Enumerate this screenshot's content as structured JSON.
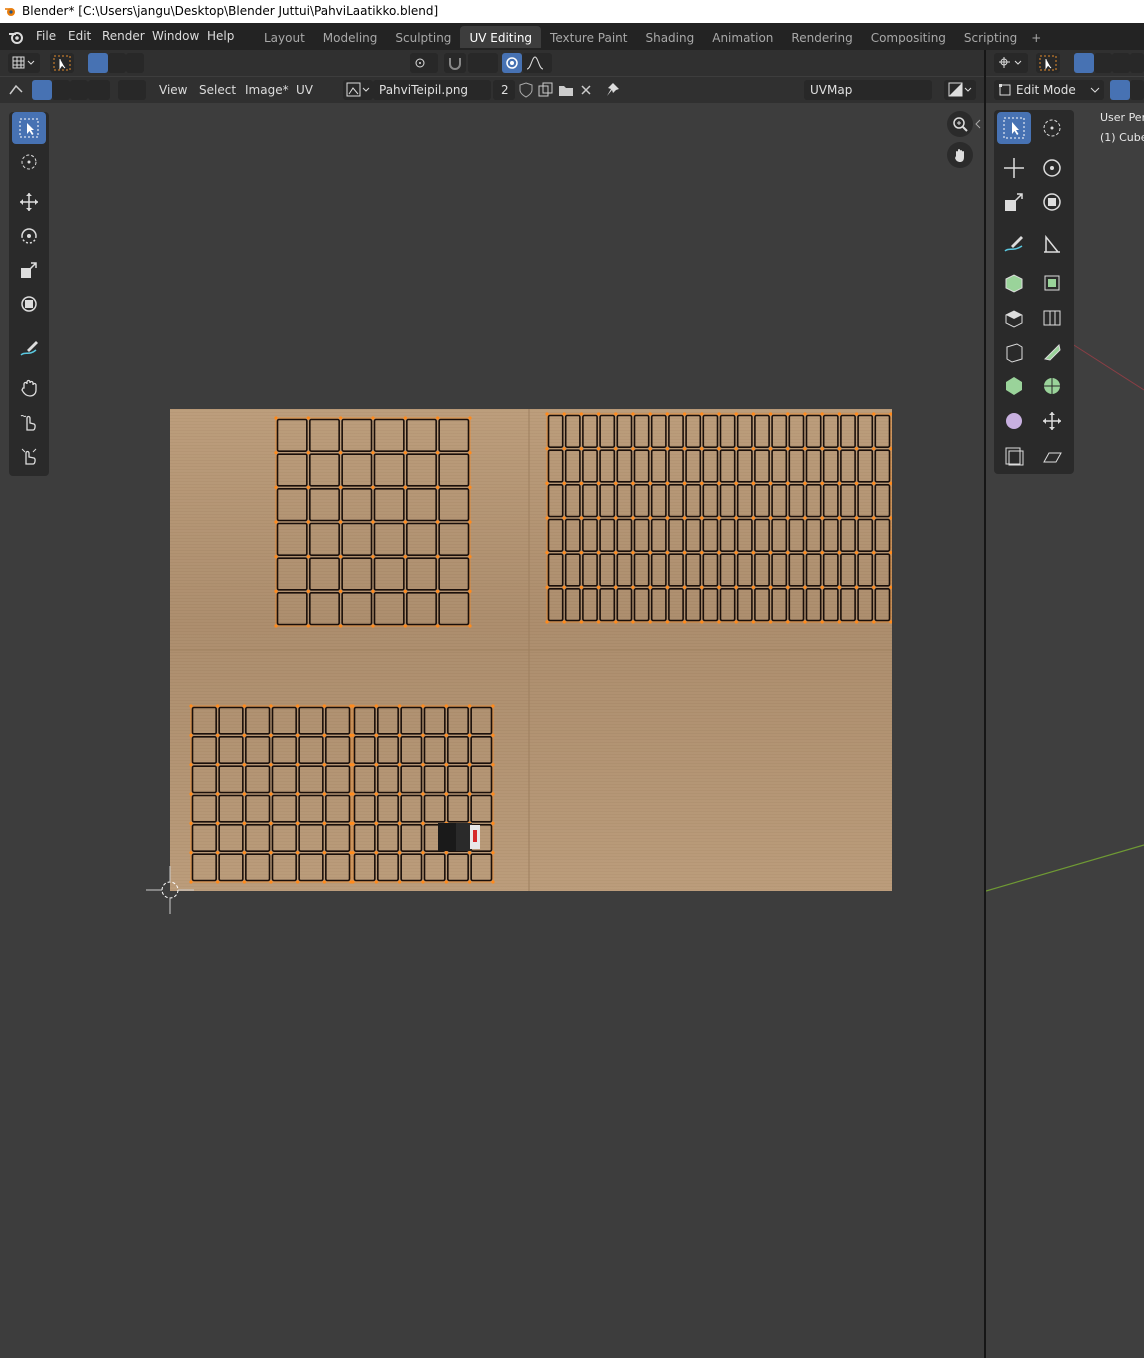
{
  "window": {
    "title": "Blender* [C:\\Users\\jangu\\Desktop\\Blender Juttui\\PahviLaatikko.blend]"
  },
  "menu": [
    "File",
    "Edit",
    "Render",
    "Window",
    "Help"
  ],
  "workspace_tabs": [
    {
      "label": "Layout",
      "active": false
    },
    {
      "label": "Modeling",
      "active": false
    },
    {
      "label": "Sculpting",
      "active": false
    },
    {
      "label": "UV Editing",
      "active": true
    },
    {
      "label": "Texture Paint",
      "active": false
    },
    {
      "label": "Shading",
      "active": false
    },
    {
      "label": "Animation",
      "active": false
    },
    {
      "label": "Rendering",
      "active": false
    },
    {
      "label": "Compositing",
      "active": false
    },
    {
      "label": "Scripting",
      "active": false
    }
  ],
  "workspace_add": "+",
  "uv_editor": {
    "header_menus": [
      "View",
      "Select",
      "Image*",
      "UV"
    ],
    "image_name": "PahviTeipil.png",
    "users_count": "2",
    "uv_map": "UVMap",
    "texture_colors": {
      "base": "#b79877",
      "light": "#c4a684",
      "dark": "#8e7154",
      "uv_edge": "#1a0f0a",
      "uv_vertex": "#ff8a1c"
    }
  },
  "viewport": {
    "mode": "Edit Mode",
    "overlay_line1": "User Pers",
    "overlay_line2": "(1) Cube"
  },
  "tools_left": [
    "select-box-icon",
    "cursor-icon",
    "move-icon",
    "rotate-icon",
    "scale-icon",
    "transform-icon",
    "annotate-icon",
    "grab-icon",
    "relax-icon",
    "pinch-icon"
  ],
  "tools_right": [
    "select-box-icon",
    "cursor-icon",
    "move-icon",
    "rotate-icon",
    "scale-icon",
    "transform-icon",
    "annotate-icon",
    "measure-icon",
    "add-cube-icon",
    "extrude-icon",
    "inset-icon",
    "bevel-icon",
    "loop-cut-icon",
    "knife-icon",
    "poly-build-icon",
    "spin-icon",
    "smooth-icon",
    "edge-slide-icon",
    "shrink-fatten-icon",
    "shear-icon",
    "rip-region-icon",
    "to-sphere-icon"
  ]
}
